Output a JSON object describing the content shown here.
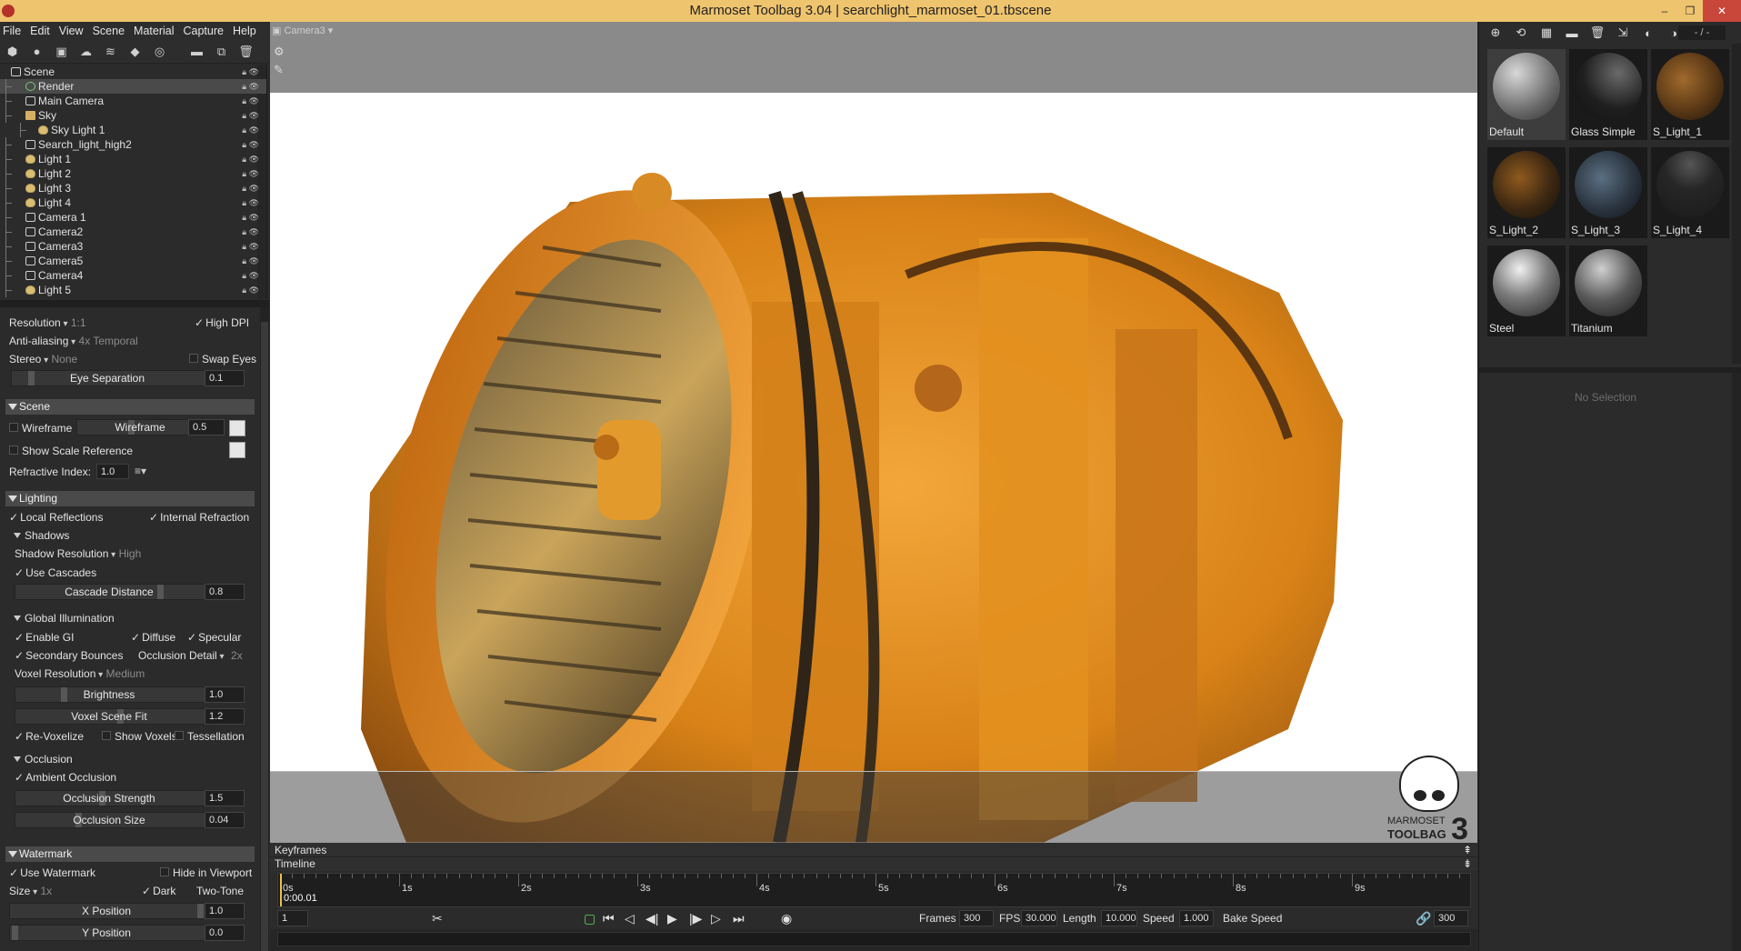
{
  "window": {
    "title": "Marmoset Toolbag 3.04  |  searchlight_marmoset_01.tbscene",
    "controls": [
      "–",
      "❐",
      "✕"
    ]
  },
  "menu": [
    "File",
    "Edit",
    "View",
    "Scene",
    "Material",
    "Capture",
    "Help"
  ],
  "toolbar_icons": [
    "add-mesh-icon",
    "add-light-icon",
    "add-camera-icon",
    "add-sky-icon",
    "add-fog-icon",
    "add-shadow-catcher-icon",
    "add-turntable-icon",
    "open-folder-icon",
    "duplicate-icon",
    "delete-icon"
  ],
  "scene_tree": [
    {
      "label": "Scene",
      "icon": "scene-icon",
      "indent": 0,
      "selected": false
    },
    {
      "label": "Render",
      "icon": "render-icon",
      "indent": 1,
      "selected": true
    },
    {
      "label": "Main Camera",
      "icon": "camera-icon",
      "indent": 1,
      "selected": false
    },
    {
      "label": "Sky",
      "icon": "sky-icon",
      "indent": 1,
      "selected": false
    },
    {
      "label": "Sky Light 1",
      "icon": "light-icon",
      "indent": 2,
      "selected": false
    },
    {
      "label": "Search_light_high2",
      "icon": "mesh-icon",
      "indent": 1,
      "selected": false
    },
    {
      "label": "Light 1",
      "icon": "light-icon",
      "indent": 1,
      "selected": false
    },
    {
      "label": "Light 2",
      "icon": "light-icon",
      "indent": 1,
      "selected": false
    },
    {
      "label": "Light 3",
      "icon": "light-icon",
      "indent": 1,
      "selected": false
    },
    {
      "label": "Light 4",
      "icon": "light-icon",
      "indent": 1,
      "selected": false
    },
    {
      "label": "Camera 1",
      "icon": "camera-icon",
      "indent": 1,
      "selected": false
    },
    {
      "label": "Camera2",
      "icon": "camera-icon",
      "indent": 1,
      "selected": false
    },
    {
      "label": "Camera3",
      "icon": "camera-icon",
      "indent": 1,
      "selected": false
    },
    {
      "label": "Camera5",
      "icon": "camera-icon",
      "indent": 1,
      "selected": false
    },
    {
      "label": "Camera4",
      "icon": "camera-icon",
      "indent": 1,
      "selected": false
    },
    {
      "label": "Light 5",
      "icon": "light-icon",
      "indent": 1,
      "selected": false
    }
  ],
  "viewport_section": {
    "resolution_label": "Resolution",
    "resolution_value": "1:1",
    "high_dpi": "High DPI",
    "aa_label": "Anti-aliasing",
    "aa_value": "4x Temporal",
    "stereo_label": "Stereo",
    "stereo_value": "None",
    "swap_eyes": "Swap Eyes",
    "eye_sep_label": "Eye Separation",
    "eye_sep_value": "0.1"
  },
  "scene_section": {
    "title": "Scene",
    "wireframe_check": "Wireframe",
    "wireframe_label": "Wireframe",
    "wireframe_value": "0.5",
    "show_scale": "Show Scale Reference",
    "refr_label": "Refractive Index:",
    "refr_value": "1.0"
  },
  "lighting_section": {
    "title": "Lighting",
    "local_refl": "Local Reflections",
    "internal_refr": "Internal Refraction",
    "shadows": "Shadows",
    "shadow_res_label": "Shadow Resolution",
    "shadow_res_value": "High",
    "use_cascades": "Use Cascades",
    "cascade_label": "Cascade Distance",
    "cascade_value": "0.8",
    "gi": "Global Illumination",
    "enable_gi": "Enable GI",
    "diffuse": "Diffuse",
    "specular": "Specular",
    "secondary": "Secondary Bounces",
    "occ_detail_label": "Occlusion Detail",
    "occ_detail_value": "2x",
    "voxel_res_label": "Voxel Resolution",
    "voxel_res_value": "Medium",
    "brightness_label": "Brightness",
    "brightness_value": "1.0",
    "voxel_fit_label": "Voxel Scene Fit",
    "voxel_fit_value": "1.2",
    "revoxelize": "Re-Voxelize",
    "show_voxels": "Show Voxels",
    "tessellation": "Tessellation",
    "occlusion": "Occlusion",
    "ambient_occ": "Ambient Occlusion",
    "occ_strength_label": "Occlusion Strength",
    "occ_strength_value": "1.5",
    "occ_size_label": "Occlusion Size",
    "occ_size_value": "0.04"
  },
  "watermark_section": {
    "title": "Watermark",
    "use_watermark": "Use Watermark",
    "hide_viewport": "Hide in Viewport",
    "size_label": "Size",
    "size_value": "1x",
    "dark": "Dark",
    "two_tone": "Two-Tone",
    "xpos_label": "X Position",
    "xpos_value": "1.0",
    "ypos_label": "Y Position",
    "ypos_value": "0.0"
  },
  "viewport": {
    "camera": "Camera3"
  },
  "watermark_logo": {
    "line1": "MARMOSET",
    "line2": "TOOLBAG",
    "version": "3"
  },
  "timeline": {
    "keyframes": "Keyframes",
    "timeline": "Timeline",
    "current_time": "0:00.01",
    "ticks": [
      "0s",
      "1s",
      "2s",
      "3s",
      "4s",
      "5s",
      "6s",
      "7s",
      "8s",
      "9s"
    ],
    "frame": "1",
    "frames_label": "Frames",
    "frames_value": "300",
    "fps_label": "FPS",
    "fps_value": "30.000",
    "length_label": "Length",
    "length_value": "10.000",
    "speed_label": "Speed",
    "speed_value": "1.000",
    "bake_speed": "Bake Speed",
    "end_frame": "300"
  },
  "materials": {
    "page": "- / -",
    "items": [
      {
        "name": "Default",
        "selected": true
      },
      {
        "name": "Glass Simple",
        "selected": false
      },
      {
        "name": "S_Light_1",
        "selected": false
      },
      {
        "name": "S_Light_2",
        "selected": false
      },
      {
        "name": "S_Light_3",
        "selected": false
      },
      {
        "name": "S_Light_4",
        "selected": false
      },
      {
        "name": "Steel",
        "selected": false
      },
      {
        "name": "Titanium",
        "selected": false
      }
    ],
    "no_selection": "No Selection"
  },
  "colors": {
    "accent": "#efc46e",
    "panel": "#2b2b2b",
    "header": "#4a4a4a"
  }
}
